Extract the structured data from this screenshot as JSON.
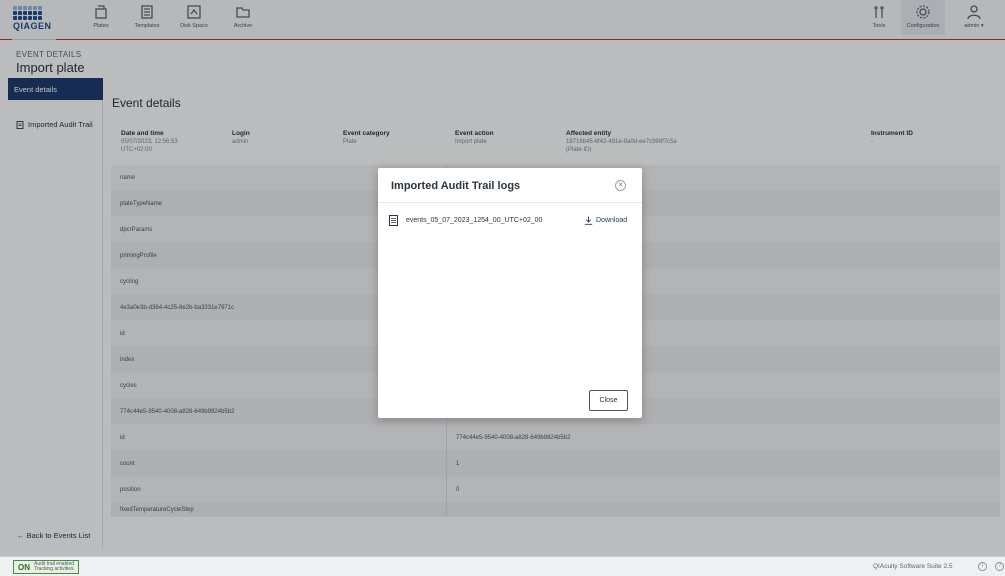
{
  "brand": {
    "logo_text": "QIAGEN"
  },
  "nav": {
    "left": [
      {
        "label": "Plates",
        "icon": "plates-icon"
      },
      {
        "label": "Templates",
        "icon": "templates-icon"
      },
      {
        "label": "Disk Space",
        "icon": "disk-space-icon"
      },
      {
        "label": "Archive",
        "icon": "archive-icon"
      }
    ],
    "right": [
      {
        "label": "Tools",
        "icon": "tools-icon"
      },
      {
        "label": "Configuration",
        "icon": "gear-icon"
      },
      {
        "label": "admin ▾",
        "icon": "user-icon"
      }
    ]
  },
  "header": {
    "section_label": "EVENT DETAILS",
    "title": "Import plate"
  },
  "sidebar": {
    "items": [
      {
        "label": "Event details",
        "active": true
      },
      {
        "label": "Imported Audit Trail",
        "active": false
      }
    ],
    "back_label": "← Back to Events List"
  },
  "main": {
    "title": "Event details",
    "meta": [
      {
        "key": "Date and time",
        "value": "05/07/2023, 12:56:53",
        "value2": "UTC+02:00"
      },
      {
        "key": "Login",
        "value": "admin",
        "value2": ""
      },
      {
        "key": "Event category",
        "value": "Plate",
        "value2": ""
      },
      {
        "key": "Event action",
        "value": "Import plate",
        "value2": ""
      },
      {
        "key": "Affected entity",
        "value": "18716b45-6f42-491e-9a0d-ee7c998f7c5a",
        "value2": "(Plate ID)"
      },
      {
        "key": "Instrument ID",
        "value": "-",
        "value2": ""
      }
    ],
    "rows": [
      {
        "c1": "name",
        "c2": ""
      },
      {
        "c1": "plateTypeName",
        "c2": ""
      },
      {
        "c1": "dpcrParams",
        "c2": ""
      },
      {
        "c1": "primingProfile",
        "c2": ""
      },
      {
        "c1": "cycling",
        "c2": ""
      },
      {
        "c1": "4e3a0e3b-d364-4c25-8e2b-ba3331e7971c",
        "c2": ""
      },
      {
        "c1": "id",
        "c2": ""
      },
      {
        "c1": "index",
        "c2": ""
      },
      {
        "c1": "cycles",
        "c2": ""
      },
      {
        "c1": "774c44e5-9540-4008-a828-649b9824b5b2",
        "c2": ""
      },
      {
        "c1": "id",
        "c2": "774c44e5-9540-4008-a828-649b9824b5b2"
      },
      {
        "c1": "count",
        "c2": "1"
      },
      {
        "c1": "position",
        "c2": "0"
      },
      {
        "c1": "fixedTemperatureCycleStep",
        "c2": ""
      }
    ]
  },
  "modal": {
    "title": "Imported Audit Trail logs",
    "close_symbol": "✕",
    "file_name": "events_05_07_2023_1254_00_UTC+02_00",
    "download_label": "Download",
    "close_label": "Close"
  },
  "footer": {
    "badge_on": "ON",
    "badge_line1": "Audit trail enabled",
    "badge_line2": "Tracking activities.",
    "version": "QIAcuity Software Suite 2.5",
    "info_symbol": "i",
    "help_symbol": "?"
  },
  "colors": {
    "accent": "#1e3a6b",
    "brand_red": "#c0392b",
    "brand_blue": "#1f4f8a"
  }
}
